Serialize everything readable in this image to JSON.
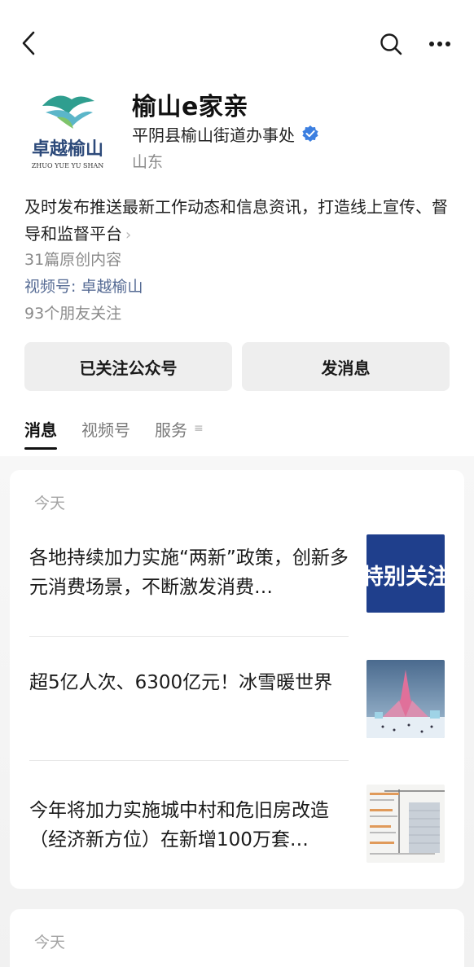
{
  "nav": {
    "back_icon": "chevron-left-icon",
    "search_icon": "search-icon",
    "more_icon": "more-horizontal-icon"
  },
  "profile": {
    "logo_text": "卓越榆山",
    "logo_subtext": "ZHUO YUE YU SHAN",
    "account_name": "榆山e家亲",
    "org_name": "平阴县榆山街道办事处",
    "region": "山东",
    "description": "及时发布推送最新工作动态和信息资讯，打造线上宣传、督导和监督平台",
    "original_count": "31篇原创内容",
    "channel": "视频号: 卓越榆山",
    "friends_following": "93个朋友关注",
    "verified_color": "#3c7fe0"
  },
  "actions": {
    "follow_label": "已关注公众号",
    "message_label": "发消息"
  },
  "tabs": [
    {
      "label": "消息",
      "active": true
    },
    {
      "label": "视频号",
      "active": false
    },
    {
      "label": "服务",
      "active": false
    }
  ],
  "feed": [
    {
      "day": "今天",
      "items": [
        {
          "title": "各地持续加力实施“两新”政策，创新多元消费场景，不断激发消费…",
          "thumb_text": "特别关注"
        },
        {
          "title": "超5亿人次、6300亿元！冰雪暖世界"
        },
        {
          "title": "今年将加力实施城中村和危旧房改造（经济新方位）在新增100万套…"
        }
      ]
    },
    {
      "day": "今天",
      "items": []
    }
  ]
}
